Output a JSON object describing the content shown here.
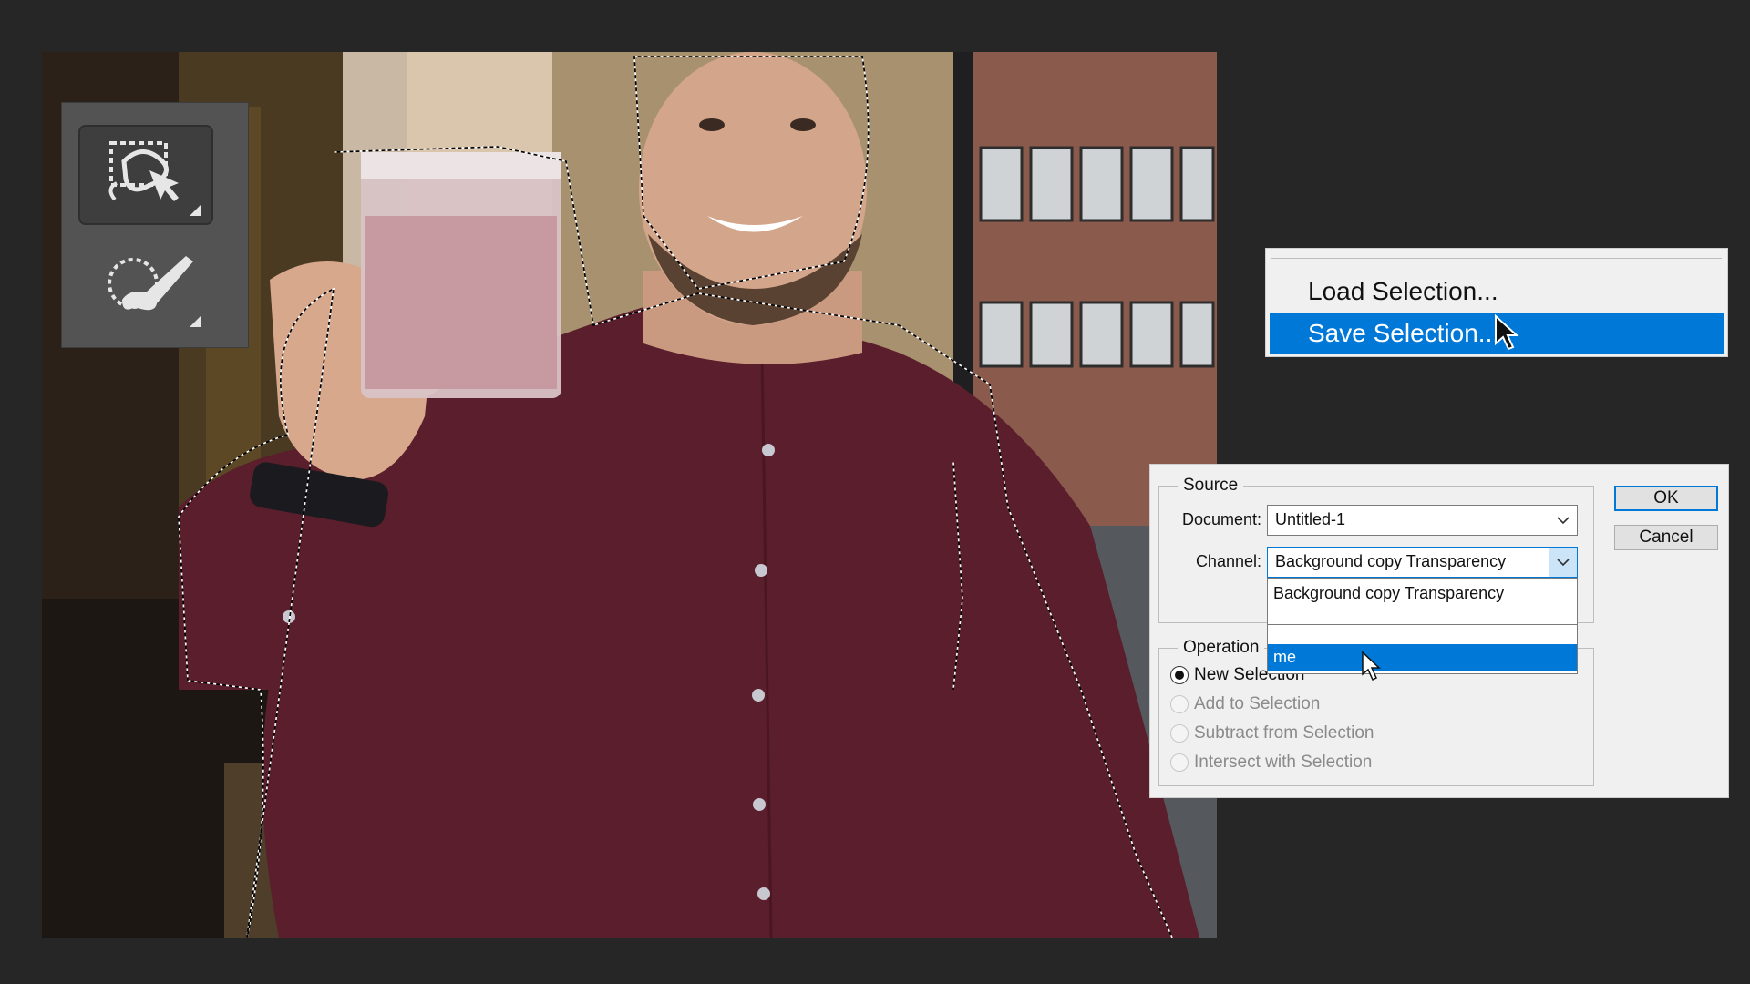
{
  "context_menu": {
    "items": [
      {
        "label": "Load Selection...",
        "highlighted": false
      },
      {
        "label": "Save Selection...",
        "highlighted": true
      }
    ]
  },
  "dialog": {
    "source_group_label": "Source",
    "document_label": "Document:",
    "document_value": "Untitled-1",
    "channel_label": "Channel:",
    "channel_value": "Background copy Transparency",
    "channel_options": [
      "Background copy Transparency",
      "",
      "me"
    ],
    "channel_selected_option": "me",
    "operation_group_label": "Operation",
    "operations": [
      {
        "label": "New Selection",
        "checked": true,
        "enabled": true
      },
      {
        "label": "Add to Selection",
        "checked": false,
        "enabled": false
      },
      {
        "label": "Subtract from Selection",
        "checked": false,
        "enabled": false
      },
      {
        "label": "Intersect with Selection",
        "checked": false,
        "enabled": false
      }
    ],
    "ok_label": "OK",
    "cancel_label": "Cancel"
  },
  "tools": [
    {
      "name": "object-selection-tool",
      "active": true
    },
    {
      "name": "quick-selection-tool",
      "active": false
    }
  ],
  "colors": {
    "accent": "#0078d7",
    "shirt": "#5a1e2c",
    "app_background": "#262626"
  }
}
